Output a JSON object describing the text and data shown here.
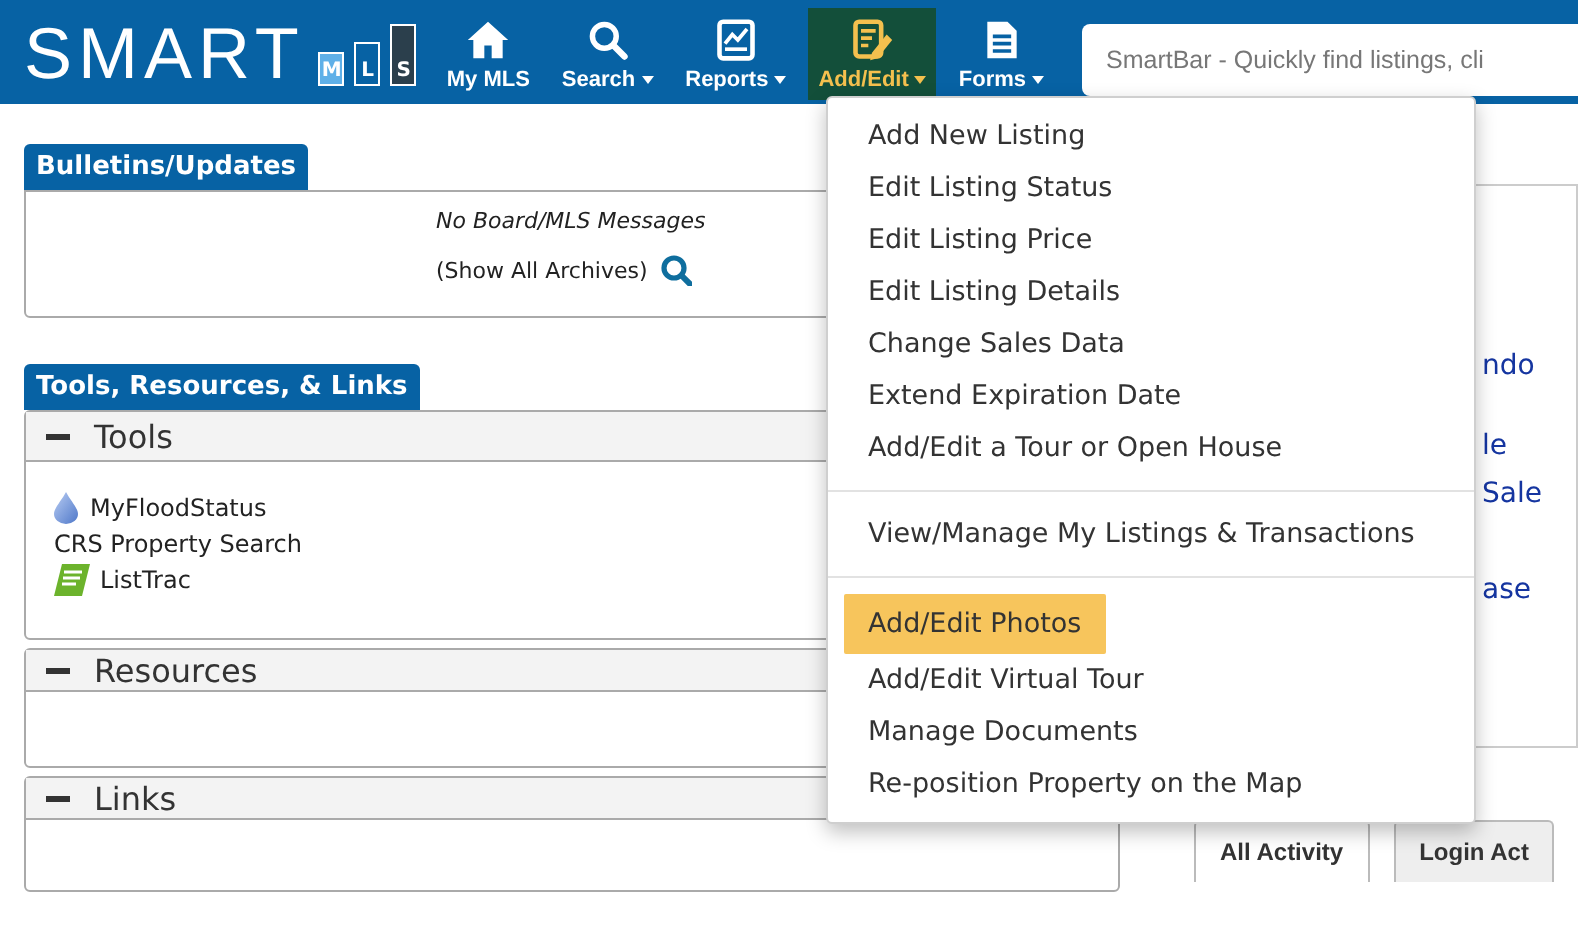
{
  "logo": {
    "name": "SMART",
    "letters": [
      "M",
      "L",
      "S"
    ]
  },
  "nav": [
    {
      "label": "My MLS",
      "caret": false,
      "selected": false
    },
    {
      "label": "Search",
      "caret": true,
      "selected": false
    },
    {
      "label": "Reports",
      "caret": true,
      "selected": false
    },
    {
      "label": "Add/Edit",
      "caret": true,
      "selected": true
    },
    {
      "label": "Forms",
      "caret": true,
      "selected": false
    }
  ],
  "smartbar": {
    "placeholder": "SmartBar - Quickly find listings, cli"
  },
  "bulletins": {
    "title": "Bulletins/Updates",
    "message": "No Board/MLS Messages",
    "archives_link": "(Show All Archives)"
  },
  "tools_panel": {
    "title": "Tools, Resources, & Links",
    "sections": [
      {
        "title": "Tools",
        "expanded": true,
        "items": [
          "MyFloodStatus",
          "CRS Property Search",
          "ListTrac"
        ]
      },
      {
        "title": "Resources",
        "expanded": true
      },
      {
        "title": "Links",
        "expanded": true
      }
    ]
  },
  "right_panel": {
    "links": [
      "ndo",
      "le",
      "Sale",
      "ase"
    ],
    "tabs": [
      {
        "label": "All Activity",
        "selected": true
      },
      {
        "label": "Login Act",
        "selected": false
      }
    ]
  },
  "add_edit_menu": {
    "groups": [
      [
        {
          "label": "Add New Listing",
          "selected": false
        },
        {
          "label": "Edit Listing Status",
          "selected": false
        },
        {
          "label": "Edit Listing Price",
          "selected": false
        },
        {
          "label": "Edit Listing Details",
          "selected": false
        },
        {
          "label": "Change Sales Data",
          "selected": false
        },
        {
          "label": "Extend Expiration Date",
          "selected": false
        },
        {
          "label": "Add/Edit a Tour or Open House",
          "selected": false
        }
      ],
      [
        {
          "label": "View/Manage My Listings & Transactions",
          "selected": false
        }
      ],
      [
        {
          "label": "Add/Edit Photos",
          "selected": true
        },
        {
          "label": "Add/Edit Virtual Tour",
          "selected": false
        },
        {
          "label": "Manage Documents",
          "selected": false
        },
        {
          "label": "Re-position Property on the Map",
          "selected": false
        }
      ]
    ]
  }
}
